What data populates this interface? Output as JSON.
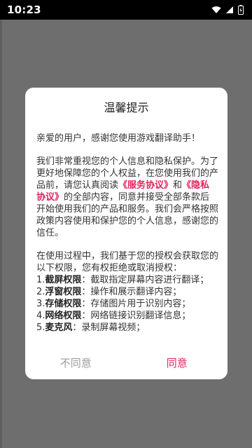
{
  "status_bar": {
    "time": "10:23",
    "icons": [
      "wifi-icon",
      "signal-icon",
      "battery-icon"
    ]
  },
  "dialog": {
    "title": "温馨提示",
    "greeting": "亲爱的用户，感谢您使用游戏翻译助手！",
    "para2": {
      "part1": "我们非常重视您的个人信息和隐私保护。为了更好地保障您的个人权益，在您使用我们的产品前，请您认真阅读",
      "link_service": "《服务协议》",
      "and": "和",
      "link_privacy": "《隐私协议》",
      "part2": "的全部内容，同意并接受全部条款后开始使用我们的产品和服务。我们会严格按照政策内容使用和保护您的个人信息，感谢您的信任。"
    },
    "para3": {
      "intro": "在使用过程中，我们基于您的授权会获取您的以下权限，您有权拒绝或取消授权：",
      "permissions": [
        {
          "num": "1.",
          "name": "截屏权限",
          "desc": "：截取指定屏幕内容进行翻译；"
        },
        {
          "num": "2.",
          "name": "浮窗权限",
          "desc": "：操作和展示翻译内容；"
        },
        {
          "num": "3.",
          "name": "存储权限",
          "desc": "：存储图片用于识别内容；"
        },
        {
          "num": "4.",
          "name": "网络权限",
          "desc": "：网络链接识别翻译信息；"
        },
        {
          "num": "5.",
          "name": "麦克风",
          "desc": "：录制屏幕视频；"
        }
      ]
    },
    "buttons": {
      "disagree": "不同意",
      "agree": "同意"
    }
  },
  "colors": {
    "accent": "#e0245e",
    "overlay": "#6e6e6e",
    "muted_button": "#9b9b9b"
  }
}
